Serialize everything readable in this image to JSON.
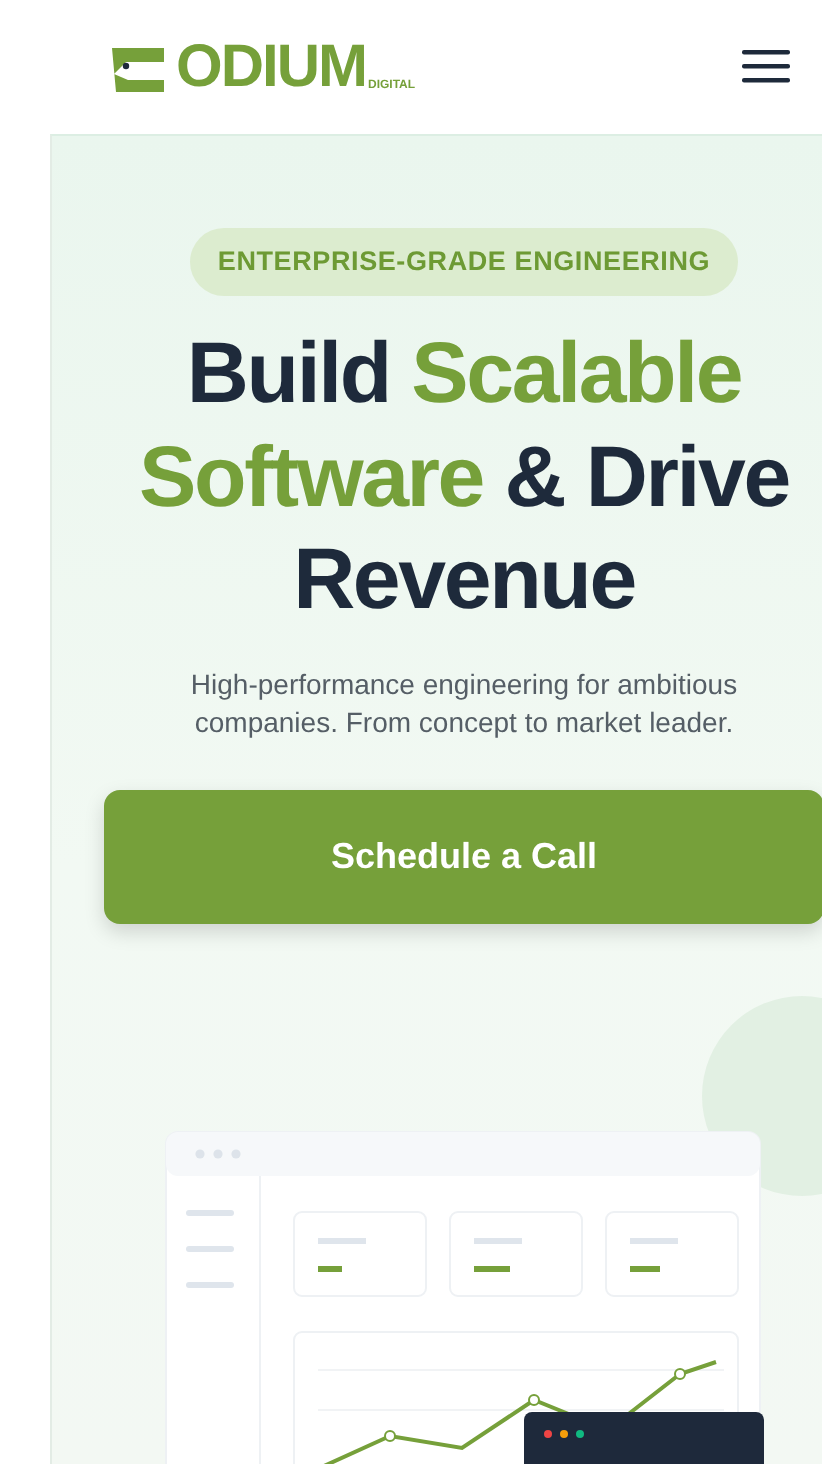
{
  "header": {
    "logo": {
      "text": "ODIUM",
      "subtext": "DIGITAL"
    }
  },
  "hero": {
    "badge": "ENTERPRISE-GRADE ENGINEERING",
    "heading": [
      {
        "text": "Build ",
        "accent": false
      },
      {
        "text": "Scalable Software",
        "accent": true
      },
      {
        "text": " & Drive Revenue",
        "accent": false
      }
    ],
    "subtitle": "High-performance engineering for ambitious companies. From concept to market leader.",
    "cta": "Schedule a Call"
  }
}
